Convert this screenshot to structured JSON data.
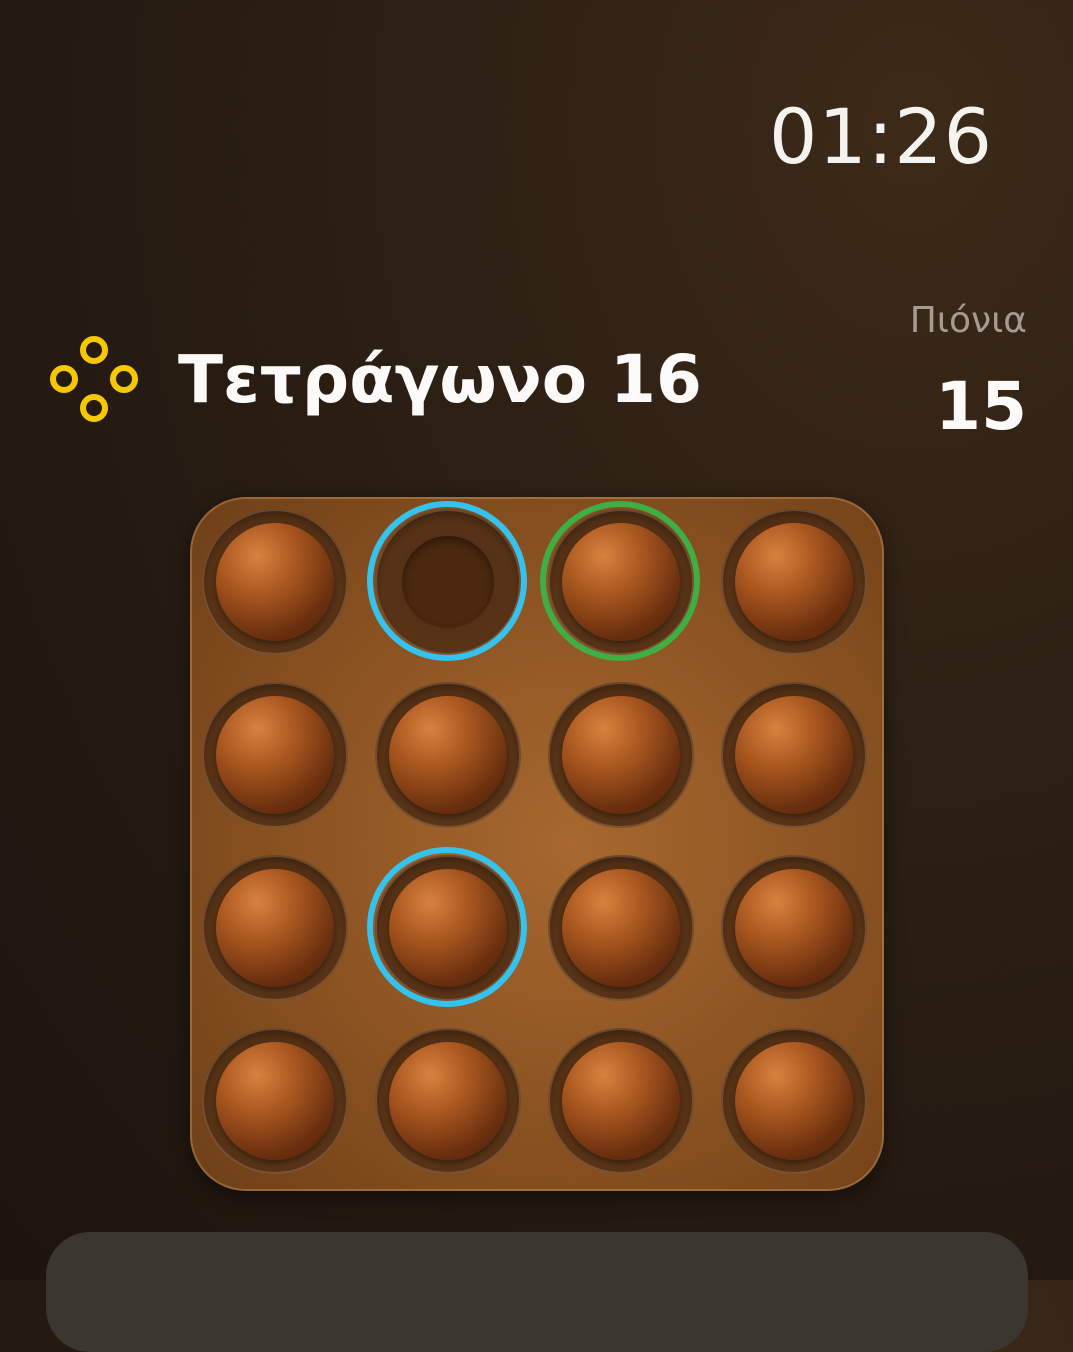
{
  "status": {
    "time": "01:26"
  },
  "puzzle": {
    "name": "Τετράγωνο 16",
    "icon": "four-rings-icon",
    "icon_color": "#f5c800"
  },
  "pieces": {
    "label": "Πιόνια",
    "count": "15"
  },
  "colors": {
    "highlight_blue": "#35c3ee",
    "highlight_green": "#3fae43",
    "board": "#8a5221"
  },
  "board": {
    "rows": 4,
    "cols": 4,
    "cells": [
      [
        "peg",
        "empty",
        "peg",
        "peg"
      ],
      [
        "peg",
        "peg",
        "peg",
        "peg"
      ],
      [
        "peg",
        "peg",
        "peg",
        "peg"
      ],
      [
        "peg",
        "peg",
        "peg",
        "peg"
      ]
    ],
    "highlights": [
      {
        "row": 0,
        "col": 1,
        "color": "blue"
      },
      {
        "row": 0,
        "col": 2,
        "color": "green"
      },
      {
        "row": 2,
        "col": 1,
        "color": "blue"
      }
    ]
  }
}
